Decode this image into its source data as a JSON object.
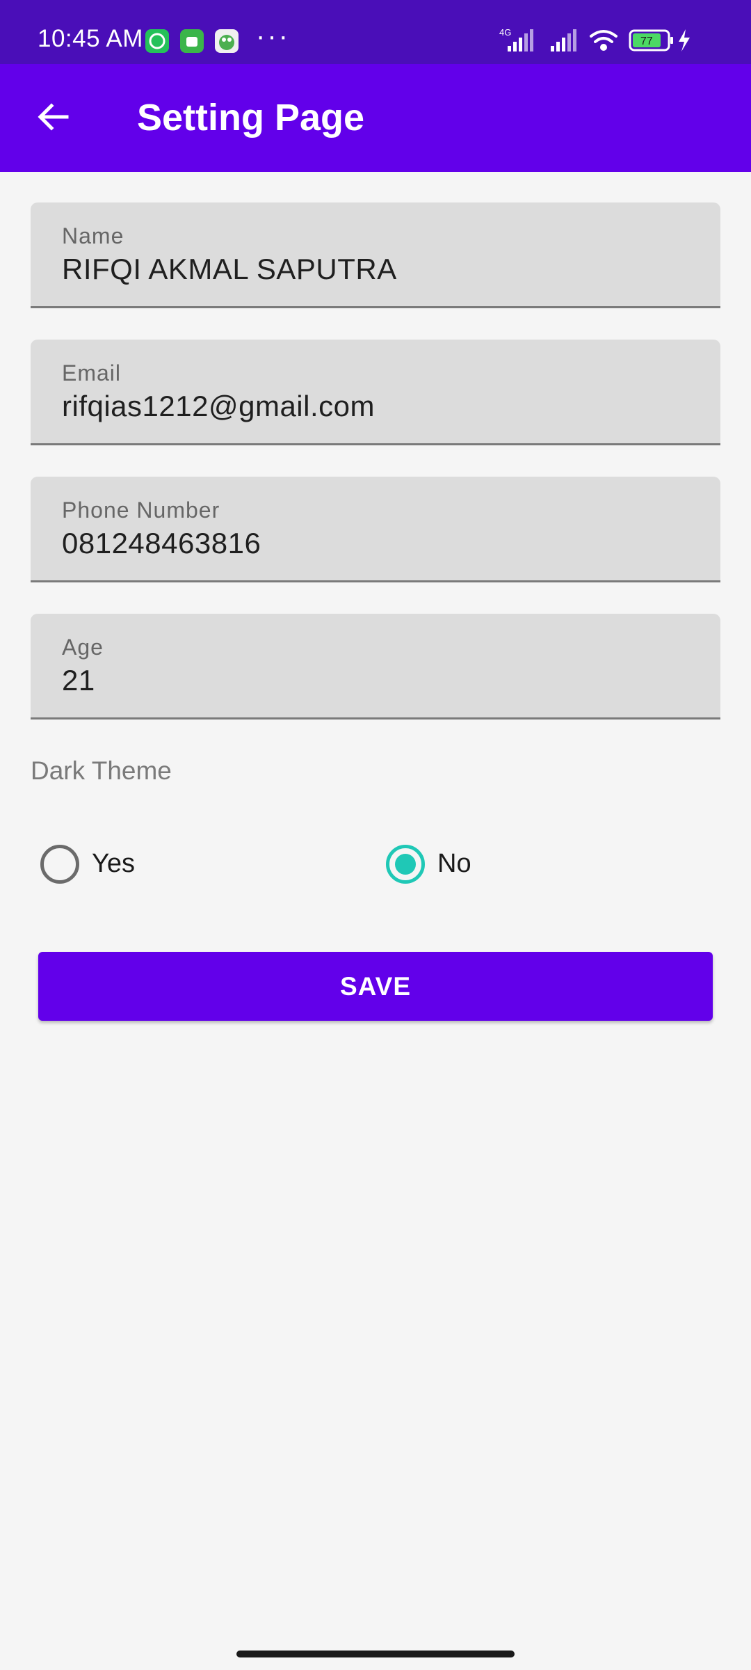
{
  "status_bar": {
    "time": "10:45 AM",
    "network": "4G",
    "battery": "77",
    "icons": [
      "whatsapp-icon",
      "android-icon",
      "app-icon",
      "more-icon",
      "signal-icon",
      "signal-icon",
      "wifi-icon",
      "battery-icon",
      "charging-icon"
    ]
  },
  "app_bar": {
    "title": "Setting Page",
    "back_icon": "arrow-back-icon"
  },
  "form": {
    "fields": [
      {
        "label": "Name",
        "value": "RIFQI AKMAL SAPUTRA"
      },
      {
        "label": "Email",
        "value": "rifqias1212@gmail.com"
      },
      {
        "label": "Phone Number",
        "value": "081248463816"
      },
      {
        "label": "Age",
        "value": "21"
      }
    ],
    "dark_theme": {
      "label": "Dark Theme",
      "options": [
        {
          "label": "Yes",
          "selected": false
        },
        {
          "label": "No",
          "selected": true
        }
      ]
    },
    "save_label": "SAVE"
  },
  "colors": {
    "primary": "#6200ea",
    "status_bar": "#4a0eb8",
    "radio_accent": "#1fc8b6"
  }
}
